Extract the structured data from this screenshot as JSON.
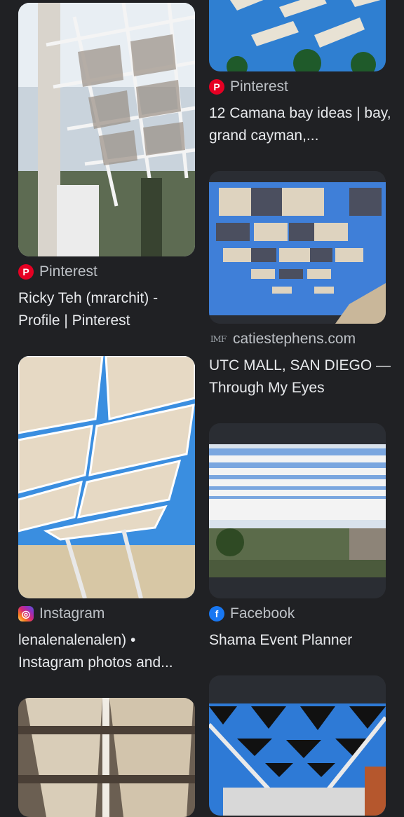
{
  "results": [
    {
      "source": "Pinterest",
      "source_icon": "pinterest-icon",
      "title": "Ricky Teh (mrarchit) - Profile | Pinterest"
    },
    {
      "source": "Pinterest",
      "source_icon": "pinterest-icon",
      "title": "12 Camana bay ideas | bay, grand cayman,..."
    },
    {
      "source": "catiestephens.com",
      "source_icon": "imf-site-icon",
      "title": "UTC MALL, SAN DIEGO — Through My Eyes"
    },
    {
      "source": "Instagram",
      "source_icon": "instagram-icon",
      "title": "lenalenalenalen) • Instagram photos and..."
    },
    {
      "source": "Facebook",
      "source_icon": "facebook-icon",
      "title": "Shama Event Planner"
    }
  ],
  "icon_glyphs": {
    "pinterest": "P",
    "facebook": "f",
    "instagram": "◎",
    "imf": "IMF"
  },
  "colors": {
    "background": "#202124",
    "text": "#e8eaed",
    "source_text": "#bdc1c6",
    "pinterest": "#e60023",
    "facebook": "#1877f2"
  }
}
